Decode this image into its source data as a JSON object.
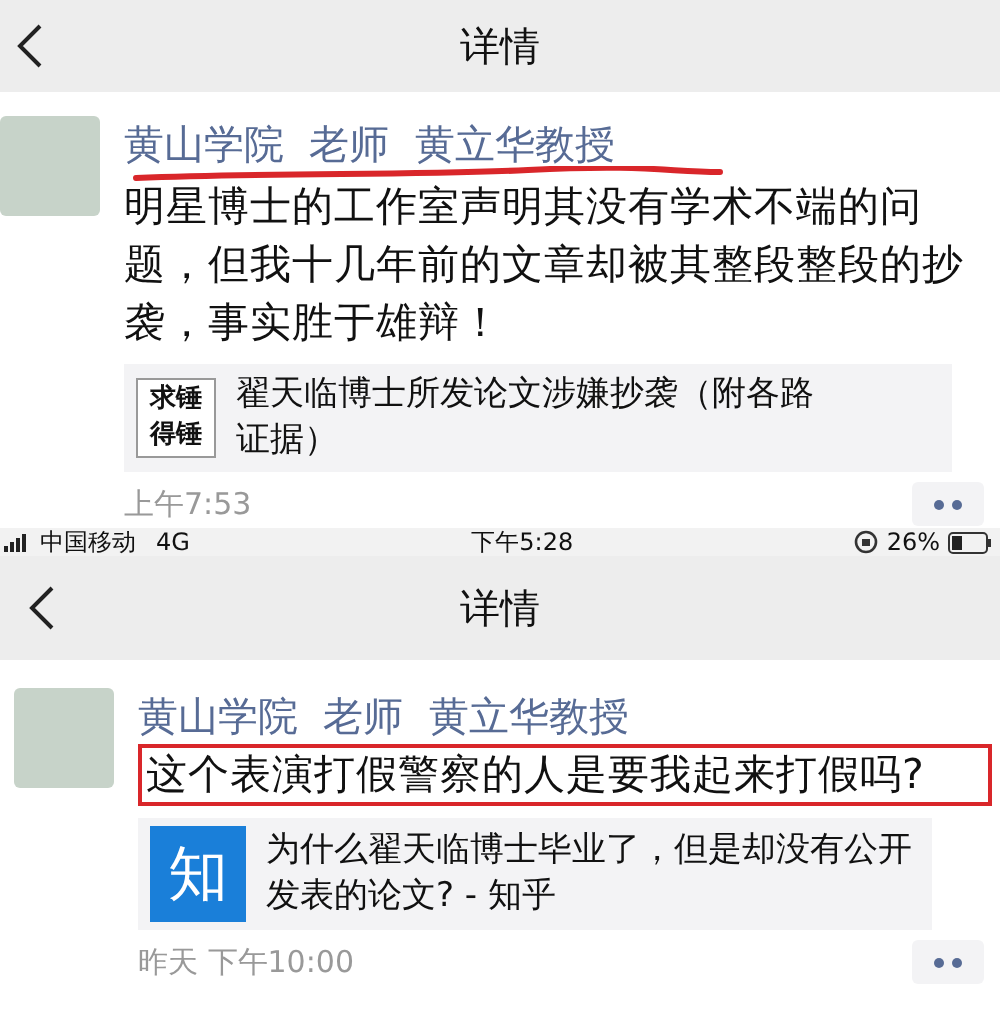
{
  "screens": [
    {
      "nav": {
        "title": "详情"
      },
      "post": {
        "author": "黄山学院  老师  黄立华教授",
        "author_underlined": true,
        "text": "明星博士的工作室声明其没有学术不端的问题，但我十几年前的文章却被其整段整段的抄袭，事实胜于雄辩！",
        "text_boxed": false,
        "link": {
          "kind": "text_thumbnail",
          "thumb_text": [
            "求锤",
            "得锤"
          ],
          "title": "翟天临博士所发论文涉嫌抄袭（附各路证据）"
        },
        "time": "上午7:53"
      }
    },
    {
      "status_bar": {
        "carrier": "中国移动",
        "network": "4G",
        "time": "下午5:28",
        "battery": "26%"
      },
      "nav": {
        "title": "详情"
      },
      "post": {
        "author": "黄山学院  老师  黄立华教授",
        "author_underlined": false,
        "text": "这个表演打假警察的人是要我起来打假吗?",
        "text_boxed": true,
        "link": {
          "kind": "logo",
          "thumb_text": [
            "知"
          ],
          "title": "为什么翟天临博士毕业了，但是却没有公开发表的论文? - 知乎"
        },
        "time": "昨天 下午10:00"
      }
    }
  ]
}
